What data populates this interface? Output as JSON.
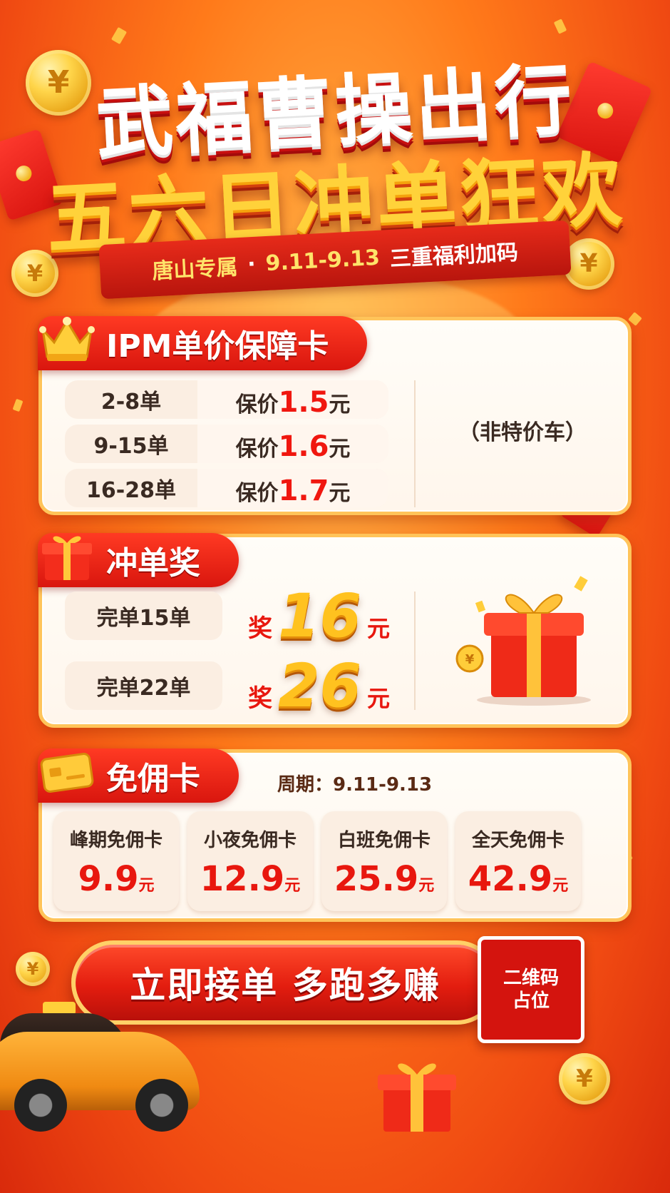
{
  "title": {
    "line1": "武福曹操出行",
    "line2": "五六日冲单狂欢"
  },
  "subtitle": {
    "region": "唐山专属",
    "sep": "·",
    "dates": "9.11-9.13",
    "tagline": "三重福利加码"
  },
  "ipm_card": {
    "title": "IPM单价保障卡",
    "note": "（非特价车）",
    "rows": [
      {
        "range": "2-8单",
        "prefix": "保价",
        "value": "1.5",
        "unit": "元"
      },
      {
        "range": "9-15单",
        "prefix": "保价",
        "value": "1.6",
        "unit": "元"
      },
      {
        "range": "16-28单",
        "prefix": "保价",
        "value": "1.7",
        "unit": "元"
      }
    ]
  },
  "reward_card": {
    "title": "冲单奖",
    "rows": [
      {
        "label": "完单15单",
        "prefix": "奖",
        "value": "16",
        "unit": "元"
      },
      {
        "label": "完单22单",
        "prefix": "奖",
        "value": "26",
        "unit": "元"
      }
    ]
  },
  "free_card": {
    "title": "免佣卡",
    "period": "周期：9.11-9.13",
    "items": [
      {
        "name": "峰期免佣卡",
        "price": "9.9",
        "unit": "元"
      },
      {
        "name": "小夜免佣卡",
        "price": "12.9",
        "unit": "元"
      },
      {
        "name": "白班免佣卡",
        "price": "25.9",
        "unit": "元"
      },
      {
        "name": "全天免佣卡",
        "price": "42.9",
        "unit": "元"
      }
    ]
  },
  "cta": {
    "label": "立即接单  多跑多赚"
  },
  "qr": {
    "line1": "二维码",
    "line2": "占位"
  },
  "icons": [
    "yuan-coin-icon",
    "red-envelope-icon",
    "crown-icon",
    "gift-box-icon",
    "card-icon",
    "taxi-icon"
  ],
  "colors": {
    "primary_red": "#e8170e",
    "gold": "#ffc21f",
    "cream": "#fffdf8"
  }
}
